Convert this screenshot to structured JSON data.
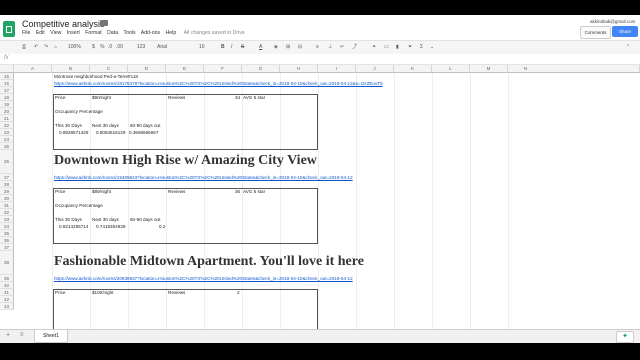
{
  "window": {
    "doc_title": "Competitive analysis",
    "account": "akkindtadi@gmail.com",
    "comments_label": "Comments",
    "share_label": "Share"
  },
  "menu": {
    "items": [
      "File",
      "Edit",
      "View",
      "Insert",
      "Format",
      "Data",
      "Tools",
      "Add-ons",
      "Help"
    ],
    "saved_status": "All changes saved in Drive"
  },
  "toolbar": {
    "zoom": "100%",
    "currency": "$",
    "percent": "%",
    "decimals_less": ".0",
    "decimals_more": ".00",
    "format_more": "123",
    "font": "Arial",
    "font_size": "10",
    "bold": "B",
    "italic": "I",
    "strike": "S",
    "text_color": "A"
  },
  "formula_bar": {
    "fx_label": "fx",
    "value": ""
  },
  "columns": [
    "A",
    "B",
    "C",
    "D",
    "E",
    "F",
    "G",
    "H",
    "I",
    "J",
    "K",
    "L",
    "M",
    "N"
  ],
  "rows": [
    "15",
    "16",
    "17",
    "18",
    "19",
    "20",
    "21",
    "22",
    "23",
    "24",
    "25",
    "26",
    "27",
    "28",
    "29",
    "30",
    "31",
    "32",
    "33",
    "34",
    "35",
    "36",
    "37",
    "38",
    "39",
    "40",
    "41",
    "42",
    "43"
  ],
  "cells": {
    "r15_b": "Montrose neighborhood Ped-a-Terre#118",
    "r16_b": "https://www.airbnb.com/rooms/18176379?location=Houston%2C%20TX%2C%20United%20States&check_in=2018-04-10&check_out=2018-04-12&s=OzZEuvT5",
    "r18_b": "Price",
    "r18_c": "$90/night",
    "r18_e": "Reviews",
    "r18_f": "34",
    "r18_g": "AVG 5 star",
    "r20_b": "Occupancy Percentage",
    "r22_b": "This 30 Days",
    "r22_c": "Next 30 days",
    "r22_d": "60-90 days out",
    "r23_b": "0.8928571429",
    "r23_c": "0.8064516129",
    "r23_d": "0.3666666667",
    "r27_b": "Downtown High Rise w/ Amazing City View",
    "r28_b": "https://www.airbnb.com/rooms/19409643?location=Houston%2C%20TX%2C%20United%20States&check_in=2018-04-10&check_out=2018-04-12",
    "r30_b": "Price",
    "r30_c": "$89/night",
    "r30_e": "Reviews",
    "r30_f": "36",
    "r30_g": "AVG 5 star",
    "r32_b": "Occupancy Percentage",
    "r34_b": "This 30 Days",
    "r34_c": "Next 30 days",
    "r34_d": "60-90 days out",
    "r35_b": "0.8214285714",
    "r35_c": "0.7419354839",
    "r35_d": "0.2",
    "r38_b": "Fashionable Midtown Apartment. You'll love it here",
    "r39_b": "https://www.airbnb.com/rooms/20938937?location=Houston%2C%20TX%2C%20United%20States&check_in=2018-04-10&check_out=2018-04-12",
    "r41_b": "Price",
    "r41_c": "$100/night",
    "r41_e": "Reviews",
    "r41_f": "2"
  },
  "sheet": {
    "add": "+",
    "list": "≡",
    "active_tab": "Sheet1",
    "explore": "✦"
  }
}
